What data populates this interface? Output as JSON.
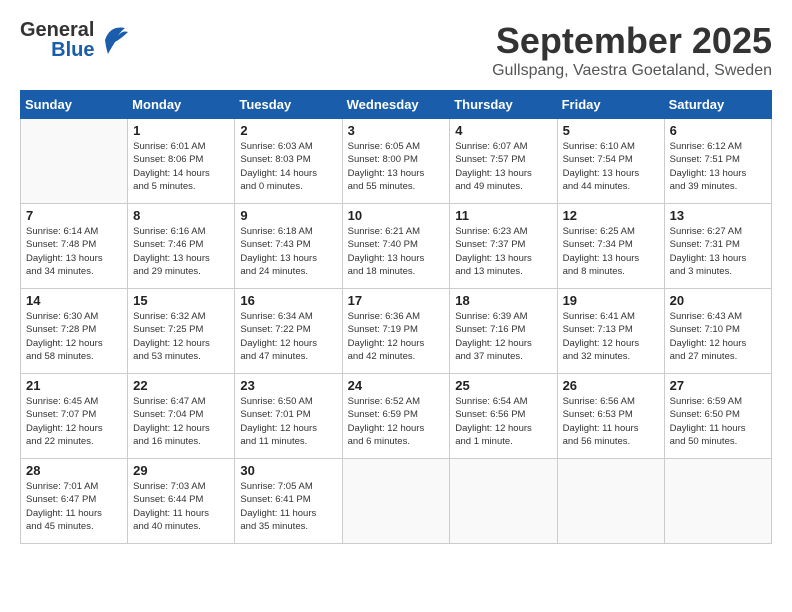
{
  "header": {
    "logo_general": "General",
    "logo_blue": "Blue",
    "month": "September 2025",
    "location": "Gullspang, Vaestra Goetaland, Sweden"
  },
  "weekdays": [
    "Sunday",
    "Monday",
    "Tuesday",
    "Wednesday",
    "Thursday",
    "Friday",
    "Saturday"
  ],
  "weeks": [
    [
      {
        "day": "",
        "info": ""
      },
      {
        "day": "1",
        "info": "Sunrise: 6:01 AM\nSunset: 8:06 PM\nDaylight: 14 hours\nand 5 minutes."
      },
      {
        "day": "2",
        "info": "Sunrise: 6:03 AM\nSunset: 8:03 PM\nDaylight: 14 hours\nand 0 minutes."
      },
      {
        "day": "3",
        "info": "Sunrise: 6:05 AM\nSunset: 8:00 PM\nDaylight: 13 hours\nand 55 minutes."
      },
      {
        "day": "4",
        "info": "Sunrise: 6:07 AM\nSunset: 7:57 PM\nDaylight: 13 hours\nand 49 minutes."
      },
      {
        "day": "5",
        "info": "Sunrise: 6:10 AM\nSunset: 7:54 PM\nDaylight: 13 hours\nand 44 minutes."
      },
      {
        "day": "6",
        "info": "Sunrise: 6:12 AM\nSunset: 7:51 PM\nDaylight: 13 hours\nand 39 minutes."
      }
    ],
    [
      {
        "day": "7",
        "info": "Sunrise: 6:14 AM\nSunset: 7:48 PM\nDaylight: 13 hours\nand 34 minutes."
      },
      {
        "day": "8",
        "info": "Sunrise: 6:16 AM\nSunset: 7:46 PM\nDaylight: 13 hours\nand 29 minutes."
      },
      {
        "day": "9",
        "info": "Sunrise: 6:18 AM\nSunset: 7:43 PM\nDaylight: 13 hours\nand 24 minutes."
      },
      {
        "day": "10",
        "info": "Sunrise: 6:21 AM\nSunset: 7:40 PM\nDaylight: 13 hours\nand 18 minutes."
      },
      {
        "day": "11",
        "info": "Sunrise: 6:23 AM\nSunset: 7:37 PM\nDaylight: 13 hours\nand 13 minutes."
      },
      {
        "day": "12",
        "info": "Sunrise: 6:25 AM\nSunset: 7:34 PM\nDaylight: 13 hours\nand 8 minutes."
      },
      {
        "day": "13",
        "info": "Sunrise: 6:27 AM\nSunset: 7:31 PM\nDaylight: 13 hours\nand 3 minutes."
      }
    ],
    [
      {
        "day": "14",
        "info": "Sunrise: 6:30 AM\nSunset: 7:28 PM\nDaylight: 12 hours\nand 58 minutes."
      },
      {
        "day": "15",
        "info": "Sunrise: 6:32 AM\nSunset: 7:25 PM\nDaylight: 12 hours\nand 53 minutes."
      },
      {
        "day": "16",
        "info": "Sunrise: 6:34 AM\nSunset: 7:22 PM\nDaylight: 12 hours\nand 47 minutes."
      },
      {
        "day": "17",
        "info": "Sunrise: 6:36 AM\nSunset: 7:19 PM\nDaylight: 12 hours\nand 42 minutes."
      },
      {
        "day": "18",
        "info": "Sunrise: 6:39 AM\nSunset: 7:16 PM\nDaylight: 12 hours\nand 37 minutes."
      },
      {
        "day": "19",
        "info": "Sunrise: 6:41 AM\nSunset: 7:13 PM\nDaylight: 12 hours\nand 32 minutes."
      },
      {
        "day": "20",
        "info": "Sunrise: 6:43 AM\nSunset: 7:10 PM\nDaylight: 12 hours\nand 27 minutes."
      }
    ],
    [
      {
        "day": "21",
        "info": "Sunrise: 6:45 AM\nSunset: 7:07 PM\nDaylight: 12 hours\nand 22 minutes."
      },
      {
        "day": "22",
        "info": "Sunrise: 6:47 AM\nSunset: 7:04 PM\nDaylight: 12 hours\nand 16 minutes."
      },
      {
        "day": "23",
        "info": "Sunrise: 6:50 AM\nSunset: 7:01 PM\nDaylight: 12 hours\nand 11 minutes."
      },
      {
        "day": "24",
        "info": "Sunrise: 6:52 AM\nSunset: 6:59 PM\nDaylight: 12 hours\nand 6 minutes."
      },
      {
        "day": "25",
        "info": "Sunrise: 6:54 AM\nSunset: 6:56 PM\nDaylight: 12 hours\nand 1 minute."
      },
      {
        "day": "26",
        "info": "Sunrise: 6:56 AM\nSunset: 6:53 PM\nDaylight: 11 hours\nand 56 minutes."
      },
      {
        "day": "27",
        "info": "Sunrise: 6:59 AM\nSunset: 6:50 PM\nDaylight: 11 hours\nand 50 minutes."
      }
    ],
    [
      {
        "day": "28",
        "info": "Sunrise: 7:01 AM\nSunset: 6:47 PM\nDaylight: 11 hours\nand 45 minutes."
      },
      {
        "day": "29",
        "info": "Sunrise: 7:03 AM\nSunset: 6:44 PM\nDaylight: 11 hours\nand 40 minutes."
      },
      {
        "day": "30",
        "info": "Sunrise: 7:05 AM\nSunset: 6:41 PM\nDaylight: 11 hours\nand 35 minutes."
      },
      {
        "day": "",
        "info": ""
      },
      {
        "day": "",
        "info": ""
      },
      {
        "day": "",
        "info": ""
      },
      {
        "day": "",
        "info": ""
      }
    ]
  ]
}
